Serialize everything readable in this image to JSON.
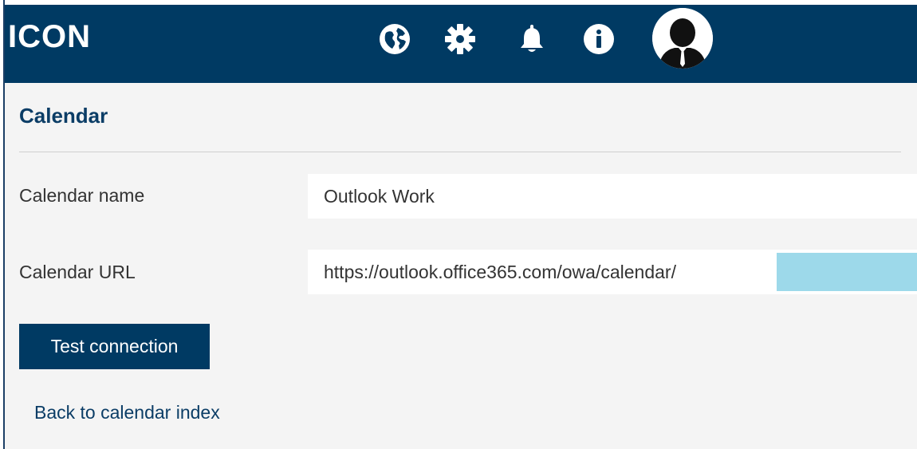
{
  "header": {
    "logo_text": "ICON",
    "icons": [
      "globe-icon",
      "gear-icon",
      "bell-icon",
      "info-icon",
      "user-avatar"
    ],
    "background_color": "#003a63"
  },
  "page": {
    "section_title": "Calendar",
    "fields": [
      {
        "label": "Calendar name",
        "value": "Outlook Work"
      },
      {
        "label": "Calendar URL",
        "value": "https://outlook.office365.com/owa/calendar/"
      }
    ],
    "test_button_label": "Test connection",
    "back_link_label": "Back to calendar index"
  },
  "colors": {
    "primary": "#003a63",
    "link": "#0b3d66",
    "content_bg": "#f4f4f4",
    "redaction": "#9dd9ea"
  }
}
